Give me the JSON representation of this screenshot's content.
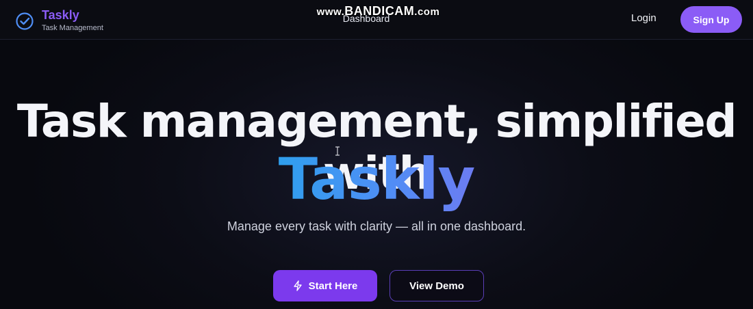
{
  "brand": {
    "name": "Taskly",
    "tagline": "Task Management",
    "accent_color": "#8b5cf6",
    "icon": "check-circle-icon"
  },
  "watermark": {
    "prefix": "www.",
    "name": "BANDICAM",
    "suffix": ".com"
  },
  "nav": {
    "center_link": "Dashboard",
    "login_label": "Login",
    "signup_label": "Sign Up"
  },
  "hero": {
    "headline": "Task management, simplified with",
    "brand_word": "Taskly",
    "subtitle": "Manage every task with clarity — all in one dashboard.",
    "primary_button": "Start Here",
    "primary_icon": "lightning-bolt-icon",
    "secondary_button": "View Demo"
  },
  "colors": {
    "primary": "#7c3aed",
    "gradient_start": "#2f9fee",
    "gradient_end": "#6c7cf2",
    "background": "#0c0d16"
  }
}
